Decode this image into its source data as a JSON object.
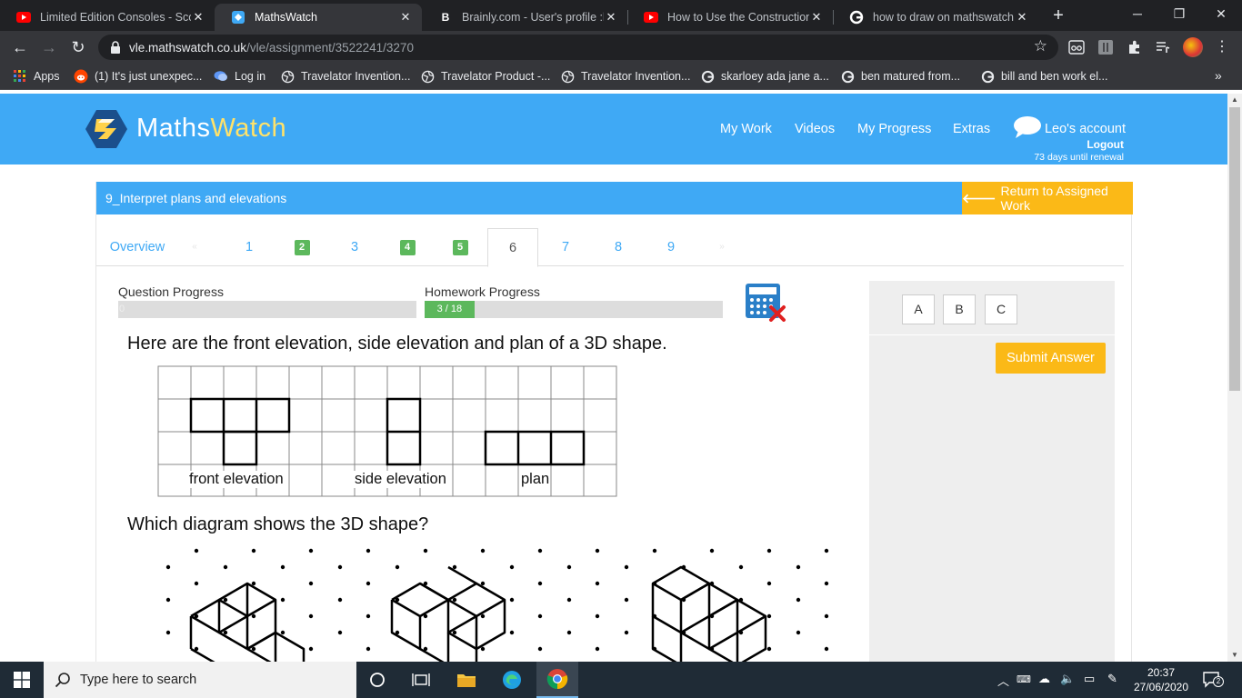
{
  "browser": {
    "tabs": [
      {
        "title": "Limited Edition Consoles - Sco",
        "icon": "youtube-icon"
      },
      {
        "title": "MathsWatch",
        "icon": "mathswatch-icon"
      },
      {
        "title": "Brainly.com - User's profile :leo",
        "icon": "brainly-icon"
      },
      {
        "title": "How to Use the Construction T",
        "icon": "youtube-icon"
      },
      {
        "title": "how to draw on mathswatch -",
        "icon": "google-icon"
      }
    ],
    "url_host": "vle.mathswatch.co.uk",
    "url_path": "/vle/assignment/3522241/3270",
    "bookmarks": [
      {
        "label": "Apps",
        "icon": "apps-grid-icon"
      },
      {
        "label": "(1) It's just unexpec...",
        "icon": "reddit-icon"
      },
      {
        "label": "Log in",
        "icon": "chat-icon"
      },
      {
        "label": "Travelator Invention...",
        "icon": "globe-icon"
      },
      {
        "label": "Travelator Product -...",
        "icon": "globe-icon"
      },
      {
        "label": "Travelator Invention...",
        "icon": "globe-icon"
      },
      {
        "label": "skarloey ada jane a...",
        "icon": "google-icon"
      },
      {
        "label": "ben matured from...",
        "icon": "google-icon"
      },
      {
        "label": "bill and ben work el...",
        "icon": "google-icon"
      }
    ]
  },
  "site": {
    "brand_left": "Maths",
    "brand_right": "Watch",
    "nav": [
      "My Work",
      "Videos",
      "My Progress",
      "Extras"
    ],
    "account_name": "Leo's account",
    "logout": "Logout",
    "renewal": "73 days until renewal",
    "colors": {
      "header": "#3fa9f5",
      "accent": "#fbb917",
      "done": "#5cb85c"
    }
  },
  "assignment": {
    "title": "9_Interpret plans and elevations",
    "return_label": "Return to Assigned Work",
    "tabs": [
      {
        "label": "Overview",
        "state": "link"
      },
      {
        "label": "«",
        "state": "disabled"
      },
      {
        "label": "1",
        "state": "link"
      },
      {
        "label": "2",
        "state": "done"
      },
      {
        "label": "3",
        "state": "link"
      },
      {
        "label": "4",
        "state": "done"
      },
      {
        "label": "5",
        "state": "done"
      },
      {
        "label": "6",
        "state": "current"
      },
      {
        "label": "7",
        "state": "link"
      },
      {
        "label": "8",
        "state": "link"
      },
      {
        "label": "9",
        "state": "link"
      },
      {
        "label": "»",
        "state": "disabled"
      }
    ],
    "question_progress": {
      "label": "Question Progress",
      "value": 0,
      "text": "0"
    },
    "homework_progress": {
      "label": "Homework Progress",
      "done": 3,
      "total": 18,
      "text": "3 / 18"
    },
    "question": {
      "intro": "Here are the front elevation, side elevation and plan of a 3D shape.",
      "captions": [
        "front elevation",
        "side elevation",
        "plan"
      ],
      "prompt": "Which diagram shows the 3D shape?"
    },
    "options": [
      "A",
      "B",
      "C"
    ],
    "submit_label": "Submit Answer"
  },
  "taskbar": {
    "search_placeholder": "Type here to search",
    "time": "20:37",
    "date": "27/06/2020",
    "notifications": "2"
  }
}
